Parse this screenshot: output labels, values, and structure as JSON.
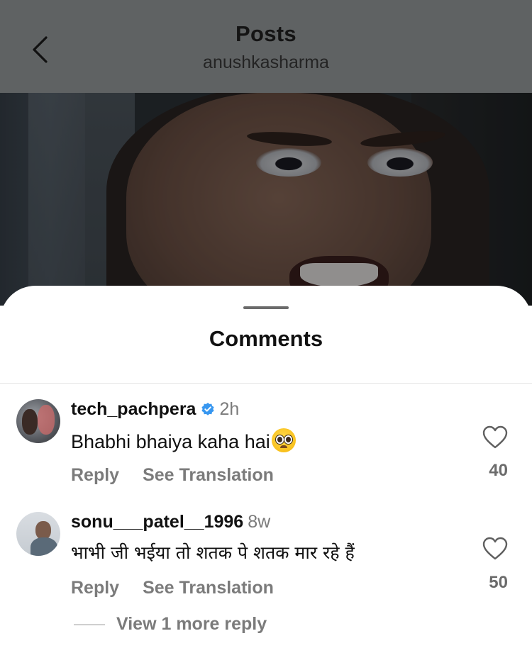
{
  "header": {
    "title": "Posts",
    "subtitle": "anushkasharma"
  },
  "sheet": {
    "title": "Comments"
  },
  "comments": [
    {
      "username": "tech_pachpera",
      "verified": true,
      "time": "2h",
      "text": "Bhabhi bhaiya kaha hai",
      "emoji": "pleading-face",
      "reply_label": "Reply",
      "translate_label": "See Translation",
      "likes": "40"
    },
    {
      "username": "sonu___patel__1996",
      "verified": false,
      "time": "8w",
      "text": "भाभी जी भईया तो शतक पे शतक मार रहे हैं",
      "reply_label": "Reply",
      "translate_label": "See Translation",
      "likes": "50"
    }
  ],
  "view_more_replies": "View 1 more reply",
  "colors": {
    "header_bg": "#5f6263",
    "verified_blue": "#3897f0",
    "muted_text": "#7b7b7b"
  },
  "icons": {
    "back": "chevron-left-icon",
    "like": "heart-outline-icon",
    "verified": "verified-badge-icon"
  }
}
